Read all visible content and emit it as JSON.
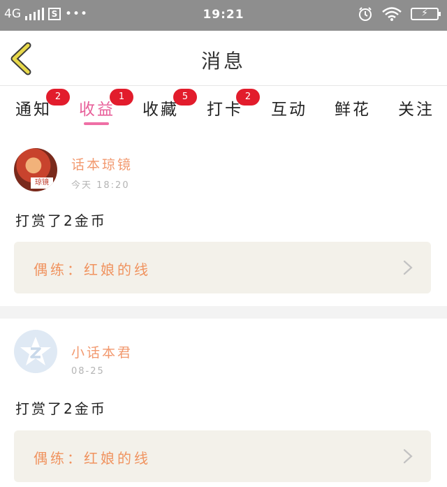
{
  "status_bar": {
    "network": "4G",
    "sim": "S",
    "dots": "•••",
    "time": "19:21",
    "battery_symbol": "⚡"
  },
  "nav": {
    "title": "消息",
    "back_icon": "back-chevron-icon",
    "accent": "#d9c43a"
  },
  "tabs": [
    {
      "label": "通知",
      "badge": "2"
    },
    {
      "label": "收益",
      "badge": "1",
      "active": true
    },
    {
      "label": "收藏",
      "badge": "5"
    },
    {
      "label": "打卡",
      "badge": "2"
    },
    {
      "label": "互动"
    },
    {
      "label": "鲜花"
    },
    {
      "label": "关注"
    }
  ],
  "messages": [
    {
      "user": "话本琼镜",
      "time": "今天 18:20",
      "avatar_label": "琼镜",
      "text": "打赏了2金币",
      "link": "偶练：红娘的线"
    },
    {
      "user": "小话本君",
      "time": "08-25",
      "text": "打赏了2金币",
      "link": "偶练：红娘的线"
    }
  ],
  "colors": {
    "active_tab": "#e8609a",
    "badge": "#e21c2c",
    "username": "#f2996f",
    "link": "#f0935f"
  }
}
